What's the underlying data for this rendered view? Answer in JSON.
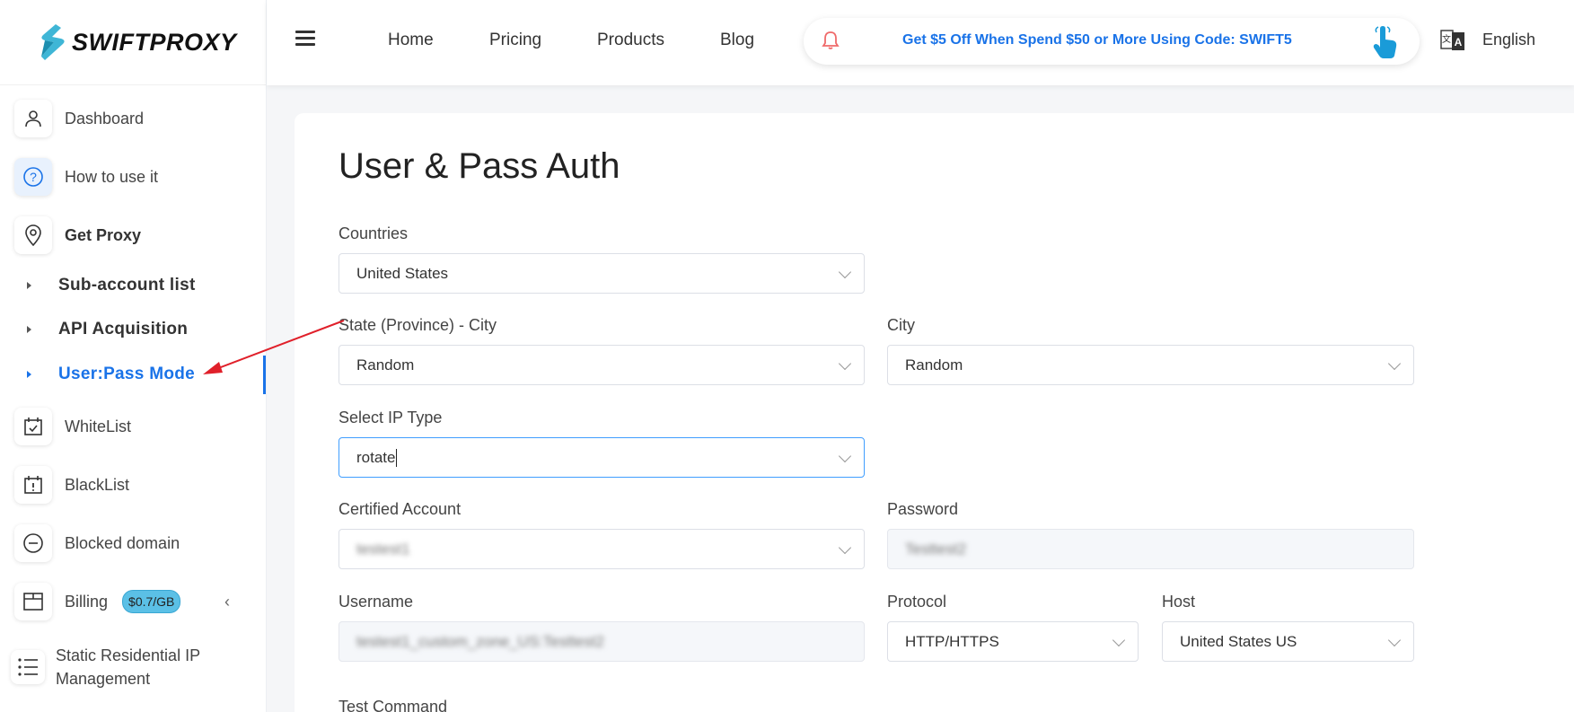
{
  "brand": {
    "name": "SWIFTPROXY"
  },
  "sidebar": {
    "items": [
      {
        "label": "Dashboard",
        "icon": "user-icon"
      },
      {
        "label": "How to use it",
        "icon": "question-icon"
      },
      {
        "label": "Get Proxy",
        "icon": "location-pin-icon"
      },
      {
        "label": "WhiteList",
        "icon": "calendar-check-icon"
      },
      {
        "label": "BlackList",
        "icon": "calendar-alert-icon"
      },
      {
        "label": "Blocked domain",
        "icon": "minus-circle-icon"
      },
      {
        "label": "Billing",
        "icon": "box-icon",
        "badge": "$0.7/GB"
      },
      {
        "label": "Static Residential IP Management",
        "icon": "list-icon"
      }
    ],
    "sub_items": [
      {
        "label": "Sub-account list"
      },
      {
        "label": "API Acquisition"
      },
      {
        "label": "User:Pass Mode",
        "active": true
      }
    ]
  },
  "header": {
    "links": [
      "Home",
      "Pricing",
      "Products",
      "Blog"
    ],
    "promo": "Get $5 Off When Spend $50 or More Using Code: SWIFT5",
    "language": "English"
  },
  "form": {
    "title": "User & Pass Auth",
    "countries": {
      "label": "Countries",
      "value": "United States"
    },
    "state": {
      "label": "State (Province) - City",
      "value": "Random"
    },
    "city": {
      "label": "City",
      "value": "Random"
    },
    "ip_type": {
      "label": "Select IP Type",
      "value": "rotate"
    },
    "account": {
      "label": "Certified Account",
      "value": "testest1"
    },
    "password": {
      "label": "Password",
      "value": "Testtest2"
    },
    "username": {
      "label": "Username",
      "value": "testest1_custom_zone_US:Testtest2"
    },
    "protocol": {
      "label": "Protocol",
      "value": "HTTP/HTTPS"
    },
    "host": {
      "label": "Host",
      "value": "United States US"
    },
    "test_command": {
      "label": "Test Command"
    }
  },
  "colors": {
    "accent": "#1a73e8",
    "badge": "#5bc0e6",
    "arrow": "#e0202a"
  }
}
